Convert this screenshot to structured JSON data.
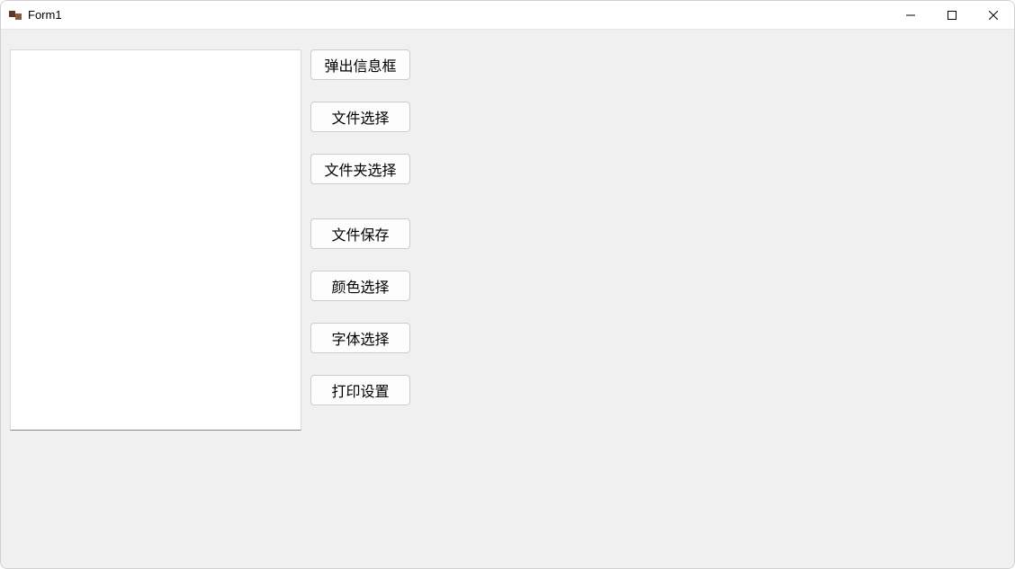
{
  "window": {
    "title": "Form1"
  },
  "textbox": {
    "value": ""
  },
  "buttons": {
    "msgbox": "弹出信息框",
    "fileOpen": "文件选择",
    "folderBrowse": "文件夹选择",
    "fileSave": "文件保存",
    "colorPick": "颜色选择",
    "fontPick": "字体选择",
    "printSetup": "打印设置"
  }
}
